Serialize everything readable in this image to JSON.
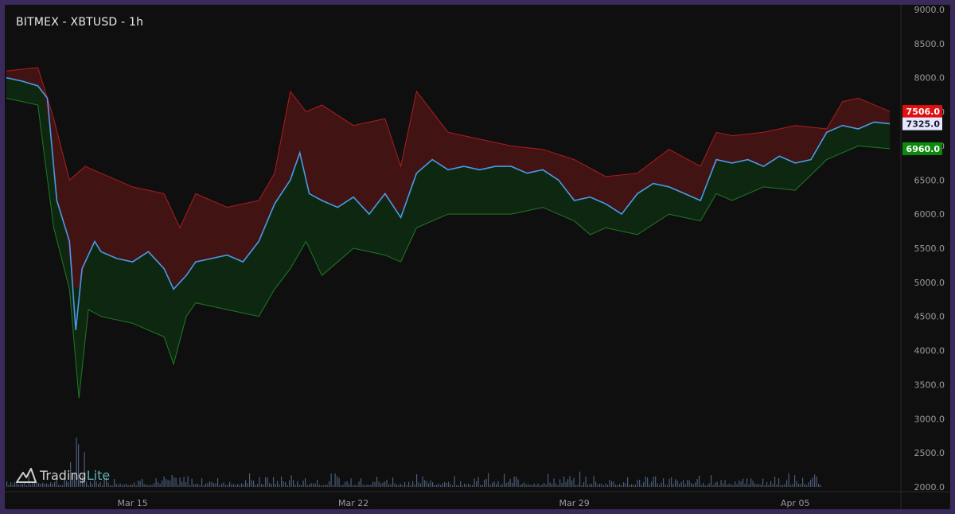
{
  "header": {
    "title": "BITMEX - XBTUSD - 1h"
  },
  "logo": {
    "name_a": "Trading",
    "name_b": "Lite",
    "icon": "tradinglite-logo-icon"
  },
  "price_tags": {
    "upper": {
      "label": "7506.0",
      "color": "#e01010"
    },
    "last": {
      "label": "7325.0",
      "color": "#e6e6ff"
    },
    "lower": {
      "label": "6960.0",
      "color": "#0d8a0d"
    }
  },
  "colors": {
    "background": "#0f0f10",
    "upper_band_fill": "#4a1414",
    "upper_band_line": "#b01c1c",
    "lower_band_fill": "#0e2a12",
    "lower_band_line": "#1f7a22",
    "price_line": "#4a9ae8",
    "volume_bar": "#4a5e7a"
  },
  "chart_data": {
    "type": "line",
    "title": "BITMEX - XBTUSD - 1h",
    "y_axis": {
      "ticks": [
        "9000.0",
        "8500.0",
        "8000.0",
        "7500.0",
        "7000.0",
        "6500.0",
        "6000.0",
        "5500.0",
        "5000.0",
        "4500.0",
        "4000.0",
        "3500.0",
        "3000.0",
        "2500.0",
        "2000.0"
      ],
      "range": [
        2000,
        9000
      ]
    },
    "x_axis": {
      "ticks": [
        "Mar 15",
        "Mar 22",
        "Mar 29",
        "Apr 05"
      ],
      "start": "Mar 11",
      "end": "Apr 08"
    },
    "series": [
      {
        "name": "",
        "role": "price",
        "points": [
          [
            "Mar 11",
            8000
          ],
          [
            "Mar 11.5",
            7950
          ],
          [
            "Mar 12",
            7880
          ],
          [
            "Mar 12.3",
            7700
          ],
          [
            "Mar 12.6",
            6200
          ],
          [
            "Mar 13",
            5600
          ],
          [
            "Mar 13.2",
            4300
          ],
          [
            "Mar 13.4",
            5200
          ],
          [
            "Mar 13.8",
            5600
          ],
          [
            "Mar 14",
            5450
          ],
          [
            "Mar 14.5",
            5350
          ],
          [
            "Mar 15",
            5300
          ],
          [
            "Mar 15.5",
            5450
          ],
          [
            "Mar 16",
            5200
          ],
          [
            "Mar 16.3",
            4900
          ],
          [
            "Mar 16.7",
            5100
          ],
          [
            "Mar 17",
            5300
          ],
          [
            "Mar 17.5",
            5350
          ],
          [
            "Mar 18",
            5400
          ],
          [
            "Mar 18.5",
            5300
          ],
          [
            "Mar 19",
            5600
          ],
          [
            "Mar 19.5",
            6150
          ],
          [
            "Mar 20",
            6500
          ],
          [
            "Mar 20.3",
            6900
          ],
          [
            "Mar 20.6",
            6300
          ],
          [
            "Mar 21",
            6200
          ],
          [
            "Mar 21.5",
            6100
          ],
          [
            "Mar 22",
            6250
          ],
          [
            "Mar 22.5",
            6000
          ],
          [
            "Mar 23",
            6300
          ],
          [
            "Mar 23.5",
            5950
          ],
          [
            "Mar 24",
            6600
          ],
          [
            "Mar 24.5",
            6800
          ],
          [
            "Mar 25",
            6650
          ],
          [
            "Mar 25.5",
            6700
          ],
          [
            "Mar 26",
            6650
          ],
          [
            "Mar 26.5",
            6700
          ],
          [
            "Mar 27",
            6700
          ],
          [
            "Mar 27.5",
            6600
          ],
          [
            "Mar 28",
            6650
          ],
          [
            "Mar 28.5",
            6500
          ],
          [
            "Mar 29",
            6200
          ],
          [
            "Mar 29.5",
            6250
          ],
          [
            "Mar 30",
            6150
          ],
          [
            "Mar 30.5",
            6000
          ],
          [
            "Mar 31",
            6300
          ],
          [
            "Mar 31.5",
            6450
          ],
          [
            "Apr 01",
            6400
          ],
          [
            "Apr 01.5",
            6300
          ],
          [
            "Apr 02",
            6200
          ],
          [
            "Apr 02.5",
            6800
          ],
          [
            "Apr 03",
            6750
          ],
          [
            "Apr 03.5",
            6800
          ],
          [
            "Apr 04",
            6700
          ],
          [
            "Apr 04.5",
            6850
          ],
          [
            "Apr 05",
            6750
          ],
          [
            "Apr 05.5",
            6800
          ],
          [
            "Apr 06",
            7200
          ],
          [
            "Apr 06.5",
            7300
          ],
          [
            "Apr 07",
            7250
          ],
          [
            "Apr 07.5",
            7350
          ],
          [
            "Apr 08",
            7325
          ]
        ]
      },
      {
        "name": "",
        "role": "upper_band",
        "points": [
          [
            "Mar 11",
            8100
          ],
          [
            "Mar 12",
            8150
          ],
          [
            "Mar 12.5",
            7400
          ],
          [
            "Mar 13",
            6500
          ],
          [
            "Mar 13.5",
            6700
          ],
          [
            "Mar 14",
            6600
          ],
          [
            "Mar 15",
            6400
          ],
          [
            "Mar 16",
            6300
          ],
          [
            "Mar 16.5",
            5800
          ],
          [
            "Mar 17",
            6300
          ],
          [
            "Mar 18",
            6100
          ],
          [
            "Mar 19",
            6200
          ],
          [
            "Mar 19.5",
            6600
          ],
          [
            "Mar 20",
            7800
          ],
          [
            "Mar 20.5",
            7500
          ],
          [
            "Mar 21",
            7600
          ],
          [
            "Mar 22",
            7300
          ],
          [
            "Mar 23",
            7400
          ],
          [
            "Mar 23.5",
            6700
          ],
          [
            "Mar 24",
            7800
          ],
          [
            "Mar 25",
            7200
          ],
          [
            "Mar 26",
            7100
          ],
          [
            "Mar 27",
            7000
          ],
          [
            "Mar 28",
            6950
          ],
          [
            "Mar 29",
            6800
          ],
          [
            "Mar 30",
            6550
          ],
          [
            "Mar 31",
            6600
          ],
          [
            "Apr 01",
            6950
          ],
          [
            "Apr 02",
            6700
          ],
          [
            "Apr 02.5",
            7200
          ],
          [
            "Apr 03",
            7150
          ],
          [
            "Apr 04",
            7200
          ],
          [
            "Apr 05",
            7300
          ],
          [
            "Apr 06",
            7250
          ],
          [
            "Apr 06.5",
            7650
          ],
          [
            "Apr 07",
            7700
          ],
          [
            "Apr 08",
            7506
          ]
        ]
      },
      {
        "name": "",
        "role": "lower_band",
        "points": [
          [
            "Mar 11",
            7700
          ],
          [
            "Mar 12",
            7600
          ],
          [
            "Mar 12.5",
            5800
          ],
          [
            "Mar 13",
            4900
          ],
          [
            "Mar 13.3",
            3300
          ],
          [
            "Mar 13.6",
            4600
          ],
          [
            "Mar 14",
            4500
          ],
          [
            "Mar 15",
            4400
          ],
          [
            "Mar 16",
            4200
          ],
          [
            "Mar 16.3",
            3800
          ],
          [
            "Mar 16.7",
            4500
          ],
          [
            "Mar 17",
            4700
          ],
          [
            "Mar 18",
            4600
          ],
          [
            "Mar 19",
            4500
          ],
          [
            "Mar 19.5",
            4900
          ],
          [
            "Mar 20",
            5200
          ],
          [
            "Mar 20.5",
            5600
          ],
          [
            "Mar 21",
            5100
          ],
          [
            "Mar 22",
            5500
          ],
          [
            "Mar 23",
            5400
          ],
          [
            "Mar 23.5",
            5300
          ],
          [
            "Mar 24",
            5800
          ],
          [
            "Mar 25",
            6000
          ],
          [
            "Mar 26",
            6000
          ],
          [
            "Mar 27",
            6000
          ],
          [
            "Mar 28",
            6100
          ],
          [
            "Mar 29",
            5900
          ],
          [
            "Mar 29.5",
            5700
          ],
          [
            "Mar 30",
            5800
          ],
          [
            "Mar 31",
            5700
          ],
          [
            "Apr 01",
            6000
          ],
          [
            "Apr 02",
            5900
          ],
          [
            "Apr 02.5",
            6300
          ],
          [
            "Apr 03",
            6200
          ],
          [
            "Apr 04",
            6400
          ],
          [
            "Apr 05",
            6350
          ],
          [
            "Apr 06",
            6800
          ],
          [
            "Apr 07",
            7000
          ],
          [
            "Apr 08",
            6960
          ]
        ]
      }
    ],
    "last_price": 7325.0,
    "upper_value": 7506.0,
    "lower_value": 6960.0,
    "grid": false,
    "has_volume": true
  }
}
